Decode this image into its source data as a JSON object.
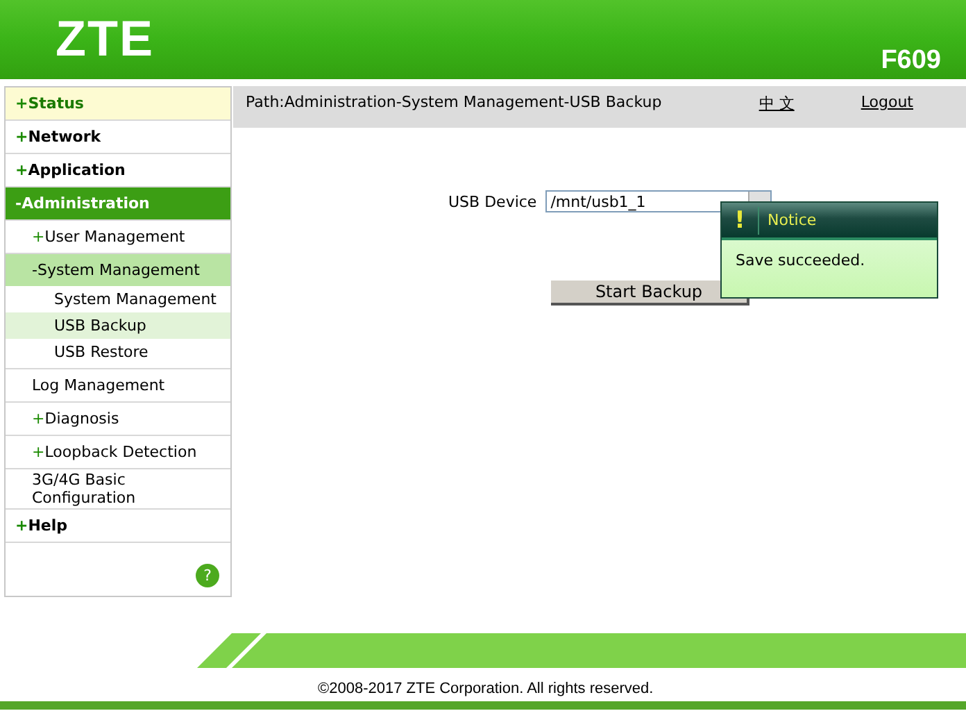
{
  "header": {
    "logo": "ZTE",
    "model": "F609"
  },
  "menu": [
    {
      "prefix": "+",
      "label": "Status",
      "hovered": true,
      "selected": false
    },
    {
      "prefix": "+",
      "label": "Network",
      "hovered": false,
      "selected": false
    },
    {
      "prefix": "+",
      "label": "Application",
      "hovered": false,
      "selected": false
    },
    {
      "prefix": "-",
      "label": "Administration",
      "hovered": false,
      "selected": true,
      "children": [
        {
          "prefix": "+",
          "label": "User Management",
          "selected": false
        },
        {
          "prefix": "-",
          "label": "System Management",
          "selected": true,
          "children": [
            {
              "label": "System Management",
              "selected": false
            },
            {
              "label": "USB Backup",
              "selected": true
            },
            {
              "label": "USB Restore",
              "selected": false
            }
          ]
        },
        {
          "label": "Log Management",
          "selected": false
        },
        {
          "prefix": "+",
          "label": "Diagnosis",
          "selected": false
        },
        {
          "prefix": "+",
          "label": "Loopback Detection",
          "selected": false
        },
        {
          "label": "3G/4G Basic Configuration",
          "selected": false
        }
      ]
    },
    {
      "prefix": "+",
      "label": "Help",
      "hovered": false,
      "selected": false
    }
  ],
  "help_button": "?",
  "path": "Path:Administration-System Management-USB Backup",
  "language_link": "中 文",
  "logout_link": "Logout",
  "form": {
    "label": "USB Device",
    "value": "/mnt/usb1_1",
    "button": "Start Backup"
  },
  "notice": {
    "icon": "!",
    "title": "Notice",
    "message": "Save succeeded."
  },
  "footer": "©2008-2017 ZTE Corporation. All rights reserved."
}
